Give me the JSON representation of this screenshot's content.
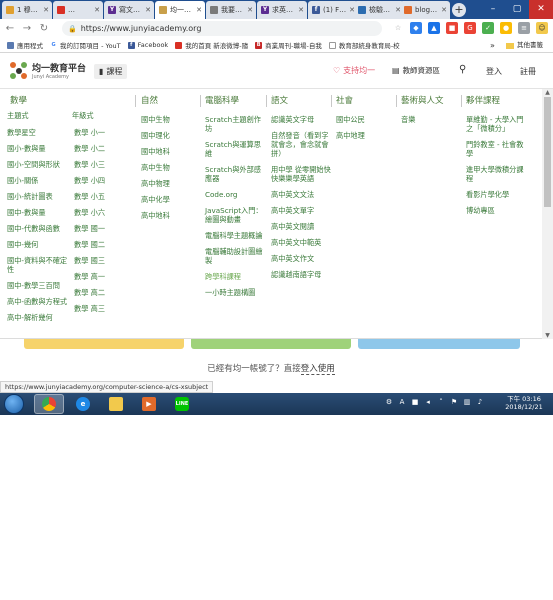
{
  "browser": {
    "tabs": [
      {
        "label": "1 穆…",
        "color": "#e0a030"
      },
      {
        "label": "…",
        "color": "#d93025"
      },
      {
        "label": "寫文…",
        "color": "#5c2d91"
      },
      {
        "label": "均一…",
        "color": "#c9a04a",
        "active": true
      },
      {
        "label": "我要…",
        "color": "#7a7a7a"
      },
      {
        "label": "求英…",
        "color": "#5c2d91"
      },
      {
        "label": "(1) F…",
        "color": "#3b5998"
      },
      {
        "label": "檢驗…",
        "color": "#2b6cb0"
      },
      {
        "label": "blog…",
        "color": "#e06a2b"
      }
    ],
    "url": "https://www.junyiacademy.org",
    "bookmarks": [
      {
        "label": "應用程式",
        "color": "#5a7ab0"
      },
      {
        "label": "我的訂閱項目 - YouT",
        "color": "#d93025"
      },
      {
        "label": "Facebook",
        "color": "#3b5998"
      },
      {
        "label": "我的首頁 新浪微博-隨",
        "color": "#d93025"
      },
      {
        "label": "商業周刊-職場-自我",
        "color": "#c62828"
      },
      {
        "label": "教育部統身教育局-校",
        "color": "#888888"
      }
    ],
    "bookmarks_other": "其他書籤",
    "status_url": "https://www.junyiacademy.org/computer-science-a/cs-xsubject"
  },
  "site": {
    "logo_title": "均一教育平台",
    "logo_sub": "Junyi Academy",
    "course_label": "課程",
    "donate_label": "支持均一",
    "teacher_label": "教師資源區",
    "login_label": "登入",
    "register_label": "註冊"
  },
  "menu": {
    "math": {
      "title": "數學",
      "sub_theme": "主題式",
      "sub_grade": "年級式",
      "theme_items": [
        "數學星空",
        "國小-數與量",
        "國小-空間與形狀",
        "國小-關係",
        "國小-統計圖表",
        "國中-數與量",
        "國中-代數與函數",
        "國中-幾何",
        "國中-資料與不確定性",
        "國中-數學三百問",
        "高中-函數與方程式",
        "高中-解析幾何"
      ],
      "grade_items": [
        "數學 小一",
        "數學 小二",
        "數學 小三",
        "數學 小四",
        "數學 小五",
        "數學 小六",
        "數學 國一",
        "數學 國二",
        "數學 國三",
        "數學 高一",
        "數學 高二",
        "數學 高三"
      ]
    },
    "science": {
      "title": "自然",
      "items": [
        "國中生物",
        "國中理化",
        "國中地科",
        "高中生物",
        "高中物理",
        "高中化學",
        "高中地科"
      ]
    },
    "cs": {
      "title": "電腦科學",
      "items": [
        "Scratch主題創作坊",
        "Scratch與運算思維",
        "Scratch與外部感應器",
        "Code.org",
        "JavaScript入門：繪圖與動畫",
        "電腦科學主題概論",
        "電腦輔助設計圖繪製",
        "跨學科課程",
        "一小時主題構圖"
      ]
    },
    "chinese": {
      "title": "語文",
      "items": [
        "認識英文字母",
        "自然發音（看到字就會念，會念就會拼）",
        "用中學 從零開始快快樂樂學英語",
        "高中英文文法",
        "高中英文單字",
        "高中英文閱讀",
        "高中英文中範英",
        "高中英文作文",
        "認識越南語字母"
      ]
    },
    "social": {
      "title": "社會",
      "items": [
        "國中公民",
        "高中地理"
      ]
    },
    "arts": {
      "title": "藝術與人文",
      "items": [
        "音樂"
      ]
    },
    "extra": {
      "title": "夥伴課程",
      "items": [
        "單維勤 - 大學入門之「微積分」",
        "門鈴教室 - 社會教學",
        "進甲大學微積分課程",
        "看影片學化學",
        "博幼專區"
      ]
    }
  },
  "page": {
    "prompt": "已經有均一帳號了？直接",
    "prompt_link": "登入使用"
  },
  "taskbar": {
    "clock_time": "下午 03:16",
    "clock_date": "2018/12/21"
  }
}
